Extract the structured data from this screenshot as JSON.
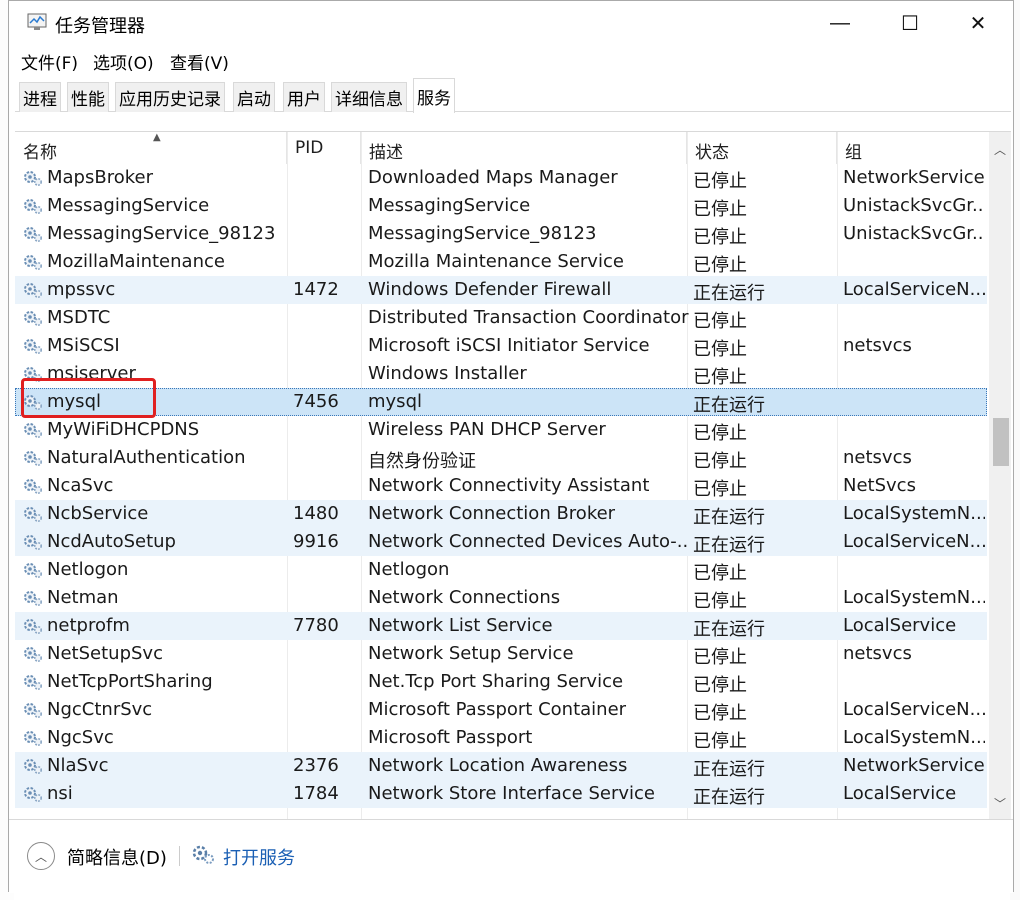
{
  "window": {
    "title": "任务管理器",
    "minimize": "—",
    "maximize": "☐",
    "close": "✕"
  },
  "menu": [
    "文件(F)",
    "选项(O)",
    "查看(V)"
  ],
  "tabs": [
    "进程",
    "性能",
    "应用历史记录",
    "启动",
    "用户",
    "详细信息",
    "服务"
  ],
  "active_tab": "服务",
  "columns": [
    "名称",
    "PID",
    "描述",
    "状态",
    "组"
  ],
  "services": [
    {
      "name": "MapsBroker",
      "pid": "",
      "desc": "Downloaded Maps Manager",
      "status": "已停止",
      "group": "NetworkService"
    },
    {
      "name": "MessagingService",
      "pid": "",
      "desc": "MessagingService",
      "status": "已停止",
      "group": "UnistackSvcGr..."
    },
    {
      "name": "MessagingService_98123",
      "pid": "",
      "desc": "MessagingService_98123",
      "status": "已停止",
      "group": "UnistackSvcGr..."
    },
    {
      "name": "MozillaMaintenance",
      "pid": "",
      "desc": "Mozilla Maintenance Service",
      "status": "已停止",
      "group": ""
    },
    {
      "name": "mpssvc",
      "pid": "1472",
      "desc": "Windows Defender Firewall",
      "status": "正在运行",
      "group": "LocalServiceN..."
    },
    {
      "name": "MSDTC",
      "pid": "",
      "desc": "Distributed Transaction Coordinator",
      "status": "已停止",
      "group": ""
    },
    {
      "name": "MSiSCSI",
      "pid": "",
      "desc": "Microsoft iSCSI Initiator Service",
      "status": "已停止",
      "group": "netsvcs"
    },
    {
      "name": "msiserver",
      "pid": "",
      "desc": "Windows Installer",
      "status": "已停止",
      "group": ""
    },
    {
      "name": "mysql",
      "pid": "7456",
      "desc": "mysql",
      "status": "正在运行",
      "group": ""
    },
    {
      "name": "MyWiFiDHCPDNS",
      "pid": "",
      "desc": "Wireless PAN DHCP Server",
      "status": "已停止",
      "group": ""
    },
    {
      "name": "NaturalAuthentication",
      "pid": "",
      "desc": "自然身份验证",
      "status": "已停止",
      "group": "netsvcs"
    },
    {
      "name": "NcaSvc",
      "pid": "",
      "desc": "Network Connectivity Assistant",
      "status": "已停止",
      "group": "NetSvcs"
    },
    {
      "name": "NcbService",
      "pid": "1480",
      "desc": "Network Connection Broker",
      "status": "正在运行",
      "group": "LocalSystemN..."
    },
    {
      "name": "NcdAutoSetup",
      "pid": "9916",
      "desc": "Network Connected Devices Auto-...",
      "status": "正在运行",
      "group": "LocalServiceN..."
    },
    {
      "name": "Netlogon",
      "pid": "",
      "desc": "Netlogon",
      "status": "已停止",
      "group": ""
    },
    {
      "name": "Netman",
      "pid": "",
      "desc": "Network Connections",
      "status": "已停止",
      "group": "LocalSystemN..."
    },
    {
      "name": "netprofm",
      "pid": "7780",
      "desc": "Network List Service",
      "status": "正在运行",
      "group": "LocalService"
    },
    {
      "name": "NetSetupSvc",
      "pid": "",
      "desc": "Network Setup Service",
      "status": "已停止",
      "group": "netsvcs"
    },
    {
      "name": "NetTcpPortSharing",
      "pid": "",
      "desc": "Net.Tcp Port Sharing Service",
      "status": "已停止",
      "group": ""
    },
    {
      "name": "NgcCtnrSvc",
      "pid": "",
      "desc": "Microsoft Passport Container",
      "status": "已停止",
      "group": "LocalServiceN..."
    },
    {
      "name": "NgcSvc",
      "pid": "",
      "desc": "Microsoft Passport",
      "status": "已停止",
      "group": "LocalSystemN..."
    },
    {
      "name": "NlaSvc",
      "pid": "2376",
      "desc": "Network Location Awareness",
      "status": "正在运行",
      "group": "NetworkService"
    },
    {
      "name": "nsi",
      "pid": "1784",
      "desc": "Network Store Interface Service",
      "status": "正在运行",
      "group": "LocalService"
    }
  ],
  "selected_service": "mysql",
  "footer": {
    "details_label": "简略信息(D)",
    "open_services_label": "打开服务"
  },
  "colors": {
    "running_row": "#eaf3fb",
    "selected_row": "#cce4f7",
    "highlight_box": "#e02020",
    "link": "#1a5fb4"
  }
}
